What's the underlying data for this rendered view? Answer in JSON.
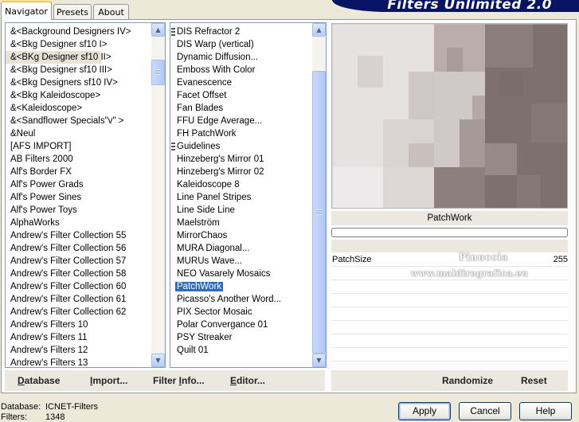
{
  "tabs": [
    {
      "label": "Navigator",
      "active": true
    },
    {
      "label": "Presets",
      "active": false
    },
    {
      "label": "About",
      "active": false
    }
  ],
  "banner_title": "Filters Unlimited 2.0",
  "categories": {
    "selected_index": 2,
    "items": [
      "&<Background Designers IV>",
      "&<Bkg Designer sf10 I>",
      "&<BKg Designer sf10 II>",
      "&<Bkg Designer sf10 III>",
      "&<Bkg Designers sf10 IV>",
      "&<Bkg Kaleidoscope>",
      "&<Kaleidoscope>",
      "&<Sandflower Specials\"v\" >",
      "&Neul",
      "[AFS IMPORT]",
      "AB Filters 2000",
      "Alf's Border FX",
      "Alf's Power Grads",
      "Alf's Power Sines",
      "Alf's Power Toys",
      "AlphaWorks",
      "Andrew's Filter Collection 55",
      "Andrew's Filter Collection 56",
      "Andrew's Filter Collection 57",
      "Andrew's Filter Collection 58",
      "Andrew's Filter Collection 60",
      "Andrew's Filter Collection 61",
      "Andrew's Filter Collection 62",
      "Andrew's Filters 10",
      "Andrew's Filters 11",
      "Andrew's Filters 12",
      "Andrew's Filters 13"
    ]
  },
  "filters": {
    "selected_index": 20,
    "items": [
      {
        "label": "DIS Refractor 2",
        "grip": true
      },
      {
        "label": "DIS Warp (vertical)",
        "grip": false
      },
      {
        "label": "Dynamic Diffusion...",
        "grip": false
      },
      {
        "label": "Emboss With Color",
        "grip": false
      },
      {
        "label": "Evanescence",
        "grip": false
      },
      {
        "label": "Facet Offset",
        "grip": false
      },
      {
        "label": "Fan Blades",
        "grip": false
      },
      {
        "label": "FFU Edge Average...",
        "grip": false
      },
      {
        "label": "FH PatchWork",
        "grip": false
      },
      {
        "label": "Guidelines",
        "grip": true
      },
      {
        "label": "Hinzeberg's Mirror 01",
        "grip": false
      },
      {
        "label": "Hinzeberg's Mirror 02",
        "grip": false
      },
      {
        "label": "Kaleidoscope 8",
        "grip": false
      },
      {
        "label": "Line Panel Stripes",
        "grip": false
      },
      {
        "label": "Line Side Line",
        "grip": false
      },
      {
        "label": "Maelström",
        "grip": false
      },
      {
        "label": "MirrorChaos",
        "grip": false
      },
      {
        "label": "MURA Diagonal...",
        "grip": false
      },
      {
        "label": "MURUs Wave...",
        "grip": false
      },
      {
        "label": "NEO Vasarely Mosaics",
        "grip": false
      },
      {
        "label": "PatchWork",
        "grip": false
      },
      {
        "label": "Picasso's Another Word...",
        "grip": false
      },
      {
        "label": "PIX Sector Mosaic",
        "grip": false
      },
      {
        "label": "Polar Convergance 01",
        "grip": false
      },
      {
        "label": "PSY Streaker",
        "grip": false
      },
      {
        "label": "Quilt 01",
        "grip": false
      }
    ]
  },
  "preview": {
    "filter_name": "PatchWork",
    "progress": 0
  },
  "params": [
    {
      "label": "PatchSize",
      "value": "255"
    }
  ],
  "watermark": {
    "line1": "Pinuccia",
    "line2": "www.maldiregrafica.eu"
  },
  "toolbar": {
    "database_u": "D",
    "database_rest": "atabase",
    "import_u": "I",
    "import_rest": "mport...",
    "filter_info_pre": "Filter ",
    "filter_info_u": "I",
    "filter_info_rest": "nfo...",
    "editor_u": "E",
    "editor_rest": "ditor...",
    "randomize": "Randomize",
    "reset": "Reset"
  },
  "footer": {
    "database_label": "Database:",
    "database_value": "ICNET-Filters",
    "filters_label": "Filters:",
    "filters_value": "1348"
  },
  "buttons": {
    "apply": "Apply",
    "cancel": "Cancel",
    "help": "Help"
  },
  "colors": {
    "selection": "#316ac5",
    "banner": "#081464",
    "window_bg": "#ece9d8"
  }
}
